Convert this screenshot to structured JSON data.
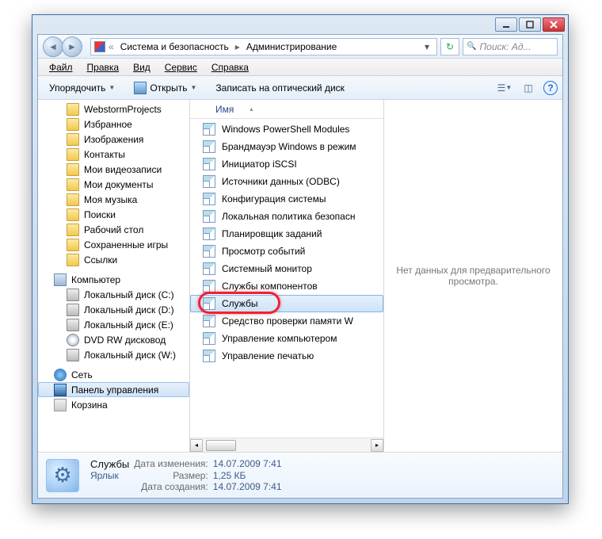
{
  "breadcrumb": {
    "root": "Система и безопасность",
    "current": "Администрирование"
  },
  "search": {
    "placeholder": "Поиск: Ад..."
  },
  "menu": {
    "file": "Файл",
    "edit": "Правка",
    "view": "Вид",
    "tools": "Сервис",
    "help": "Справка"
  },
  "toolbar": {
    "organize": "Упорядочить",
    "open": "Открыть",
    "burn": "Записать на оптический диск"
  },
  "nav": [
    {
      "label": "WebstormProjects",
      "icon": "ni-folder",
      "indent": 1
    },
    {
      "label": "Избранное",
      "icon": "ni-folder",
      "indent": 1
    },
    {
      "label": "Изображения",
      "icon": "ni-folder",
      "indent": 1
    },
    {
      "label": "Контакты",
      "icon": "ni-folder",
      "indent": 1
    },
    {
      "label": "Мои видеозаписи",
      "icon": "ni-folder",
      "indent": 1
    },
    {
      "label": "Мои документы",
      "icon": "ni-folder",
      "indent": 1
    },
    {
      "label": "Моя музыка",
      "icon": "ni-folder",
      "indent": 1
    },
    {
      "label": "Поиски",
      "icon": "ni-folder",
      "indent": 1
    },
    {
      "label": "Рабочий стол",
      "icon": "ni-folder",
      "indent": 1
    },
    {
      "label": "Сохраненные игры",
      "icon": "ni-folder",
      "indent": 1
    },
    {
      "label": "Ссылки",
      "icon": "ni-folder",
      "indent": 1
    },
    {
      "gap": true
    },
    {
      "label": "Компьютер",
      "icon": "ni-comp",
      "indent": 0
    },
    {
      "label": "Локальный диск (C:)",
      "icon": "ni-drive",
      "indent": 1
    },
    {
      "label": "Локальный диск (D:)",
      "icon": "ni-drive",
      "indent": 1
    },
    {
      "label": "Локальный диск (E:)",
      "icon": "ni-drive",
      "indent": 1
    },
    {
      "label": "DVD RW дисковод",
      "icon": "ni-dvd",
      "indent": 1
    },
    {
      "label": "Локальный диск (W:)",
      "icon": "ni-drive",
      "indent": 1
    },
    {
      "gap": true
    },
    {
      "label": "Сеть",
      "icon": "ni-net",
      "indent": 0
    },
    {
      "label": "Панель управления",
      "icon": "ni-cpl",
      "indent": 0,
      "selected": true
    },
    {
      "label": "Корзина",
      "icon": "ni-bin",
      "indent": 0
    }
  ],
  "colhdr": {
    "name": "Имя"
  },
  "files": [
    {
      "label": "Windows PowerShell Modules"
    },
    {
      "label": "Брандмауэр Windows в режим"
    },
    {
      "label": "Инициатор iSCSI"
    },
    {
      "label": "Источники данных (ODBC)"
    },
    {
      "label": "Конфигурация системы"
    },
    {
      "label": "Локальная политика безопасн"
    },
    {
      "label": "Планировщик заданий"
    },
    {
      "label": "Просмотр событий"
    },
    {
      "label": "Системный монитор"
    },
    {
      "label": "Службы компонентов"
    },
    {
      "label": "Службы",
      "selected": true
    },
    {
      "label": "Средство проверки памяти W"
    },
    {
      "label": "Управление компьютером"
    },
    {
      "label": "Управление печатью"
    }
  ],
  "preview": {
    "empty": "Нет данных для предварительного просмотра."
  },
  "details": {
    "name": "Службы",
    "type": "Ярлык",
    "labels": {
      "modified": "Дата изменения:",
      "size": "Размер:",
      "created": "Дата создания:"
    },
    "modified": "14.07.2009 7:41",
    "size": "1,25 КБ",
    "created": "14.07.2009 7:41"
  }
}
